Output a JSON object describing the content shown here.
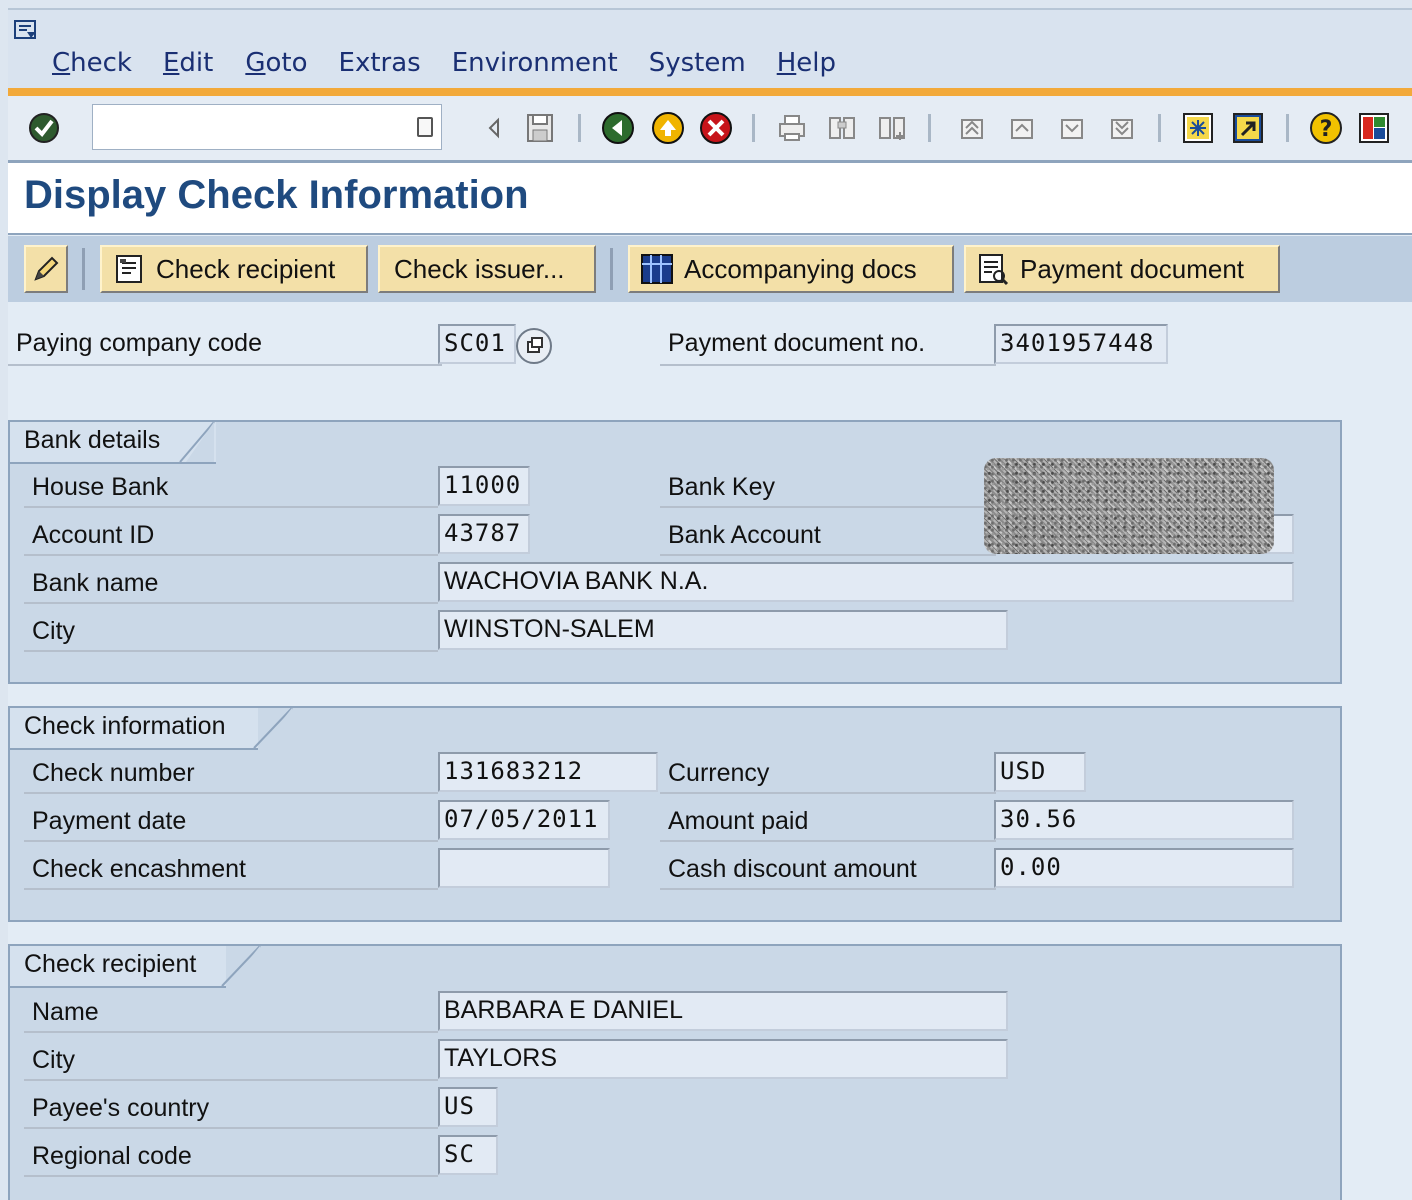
{
  "menubar": {
    "items": [
      {
        "label": "Check"
      },
      {
        "label": "Edit"
      },
      {
        "label": "Goto"
      },
      {
        "label": "Extras"
      },
      {
        "label": "Environment"
      },
      {
        "label": "System"
      },
      {
        "label": "Help"
      }
    ]
  },
  "toolbar": {
    "command_value": ""
  },
  "page": {
    "title": "Display Check Information"
  },
  "app_toolbar": {
    "check_recipient": "Check recipient",
    "check_issuer": "Check issuer...",
    "accompanying_docs": "Accompanying docs",
    "payment_document": "Payment document"
  },
  "header": {
    "paying_company_code_label": "Paying company code",
    "paying_company_code": "SC01",
    "payment_doc_no_label": "Payment document no.",
    "payment_doc_no": "3401957448"
  },
  "bank_details": {
    "title": "Bank details",
    "house_bank_label": "House Bank",
    "house_bank": "11000",
    "bank_key_label": "Bank Key",
    "account_id_label": "Account ID",
    "account_id": "43787",
    "bank_account_label": "Bank Account",
    "bank_name_label": "Bank name",
    "bank_name": "WACHOVIA BANK  N.A.",
    "city_label": "City",
    "city": "WINSTON-SALEM"
  },
  "check_info": {
    "title": "Check information",
    "check_number_label": "Check number",
    "check_number": "131683212",
    "currency_label": "Currency",
    "currency": "USD",
    "payment_date_label": "Payment date",
    "payment_date": "07/05/2011",
    "amount_paid_label": "Amount paid",
    "amount_paid": "30.56",
    "check_encashment_label": "Check encashment",
    "check_encashment": "",
    "cash_discount_label": "Cash discount amount",
    "cash_discount": "0.00"
  },
  "check_recipient": {
    "title": "Check recipient",
    "name_label": "Name",
    "name": "BARBARA E DANIEL",
    "city_label": "City",
    "city": "TAYLORS",
    "country_label": "Payee's country",
    "country": "US",
    "region_label": "Regional code",
    "region": "SC"
  }
}
